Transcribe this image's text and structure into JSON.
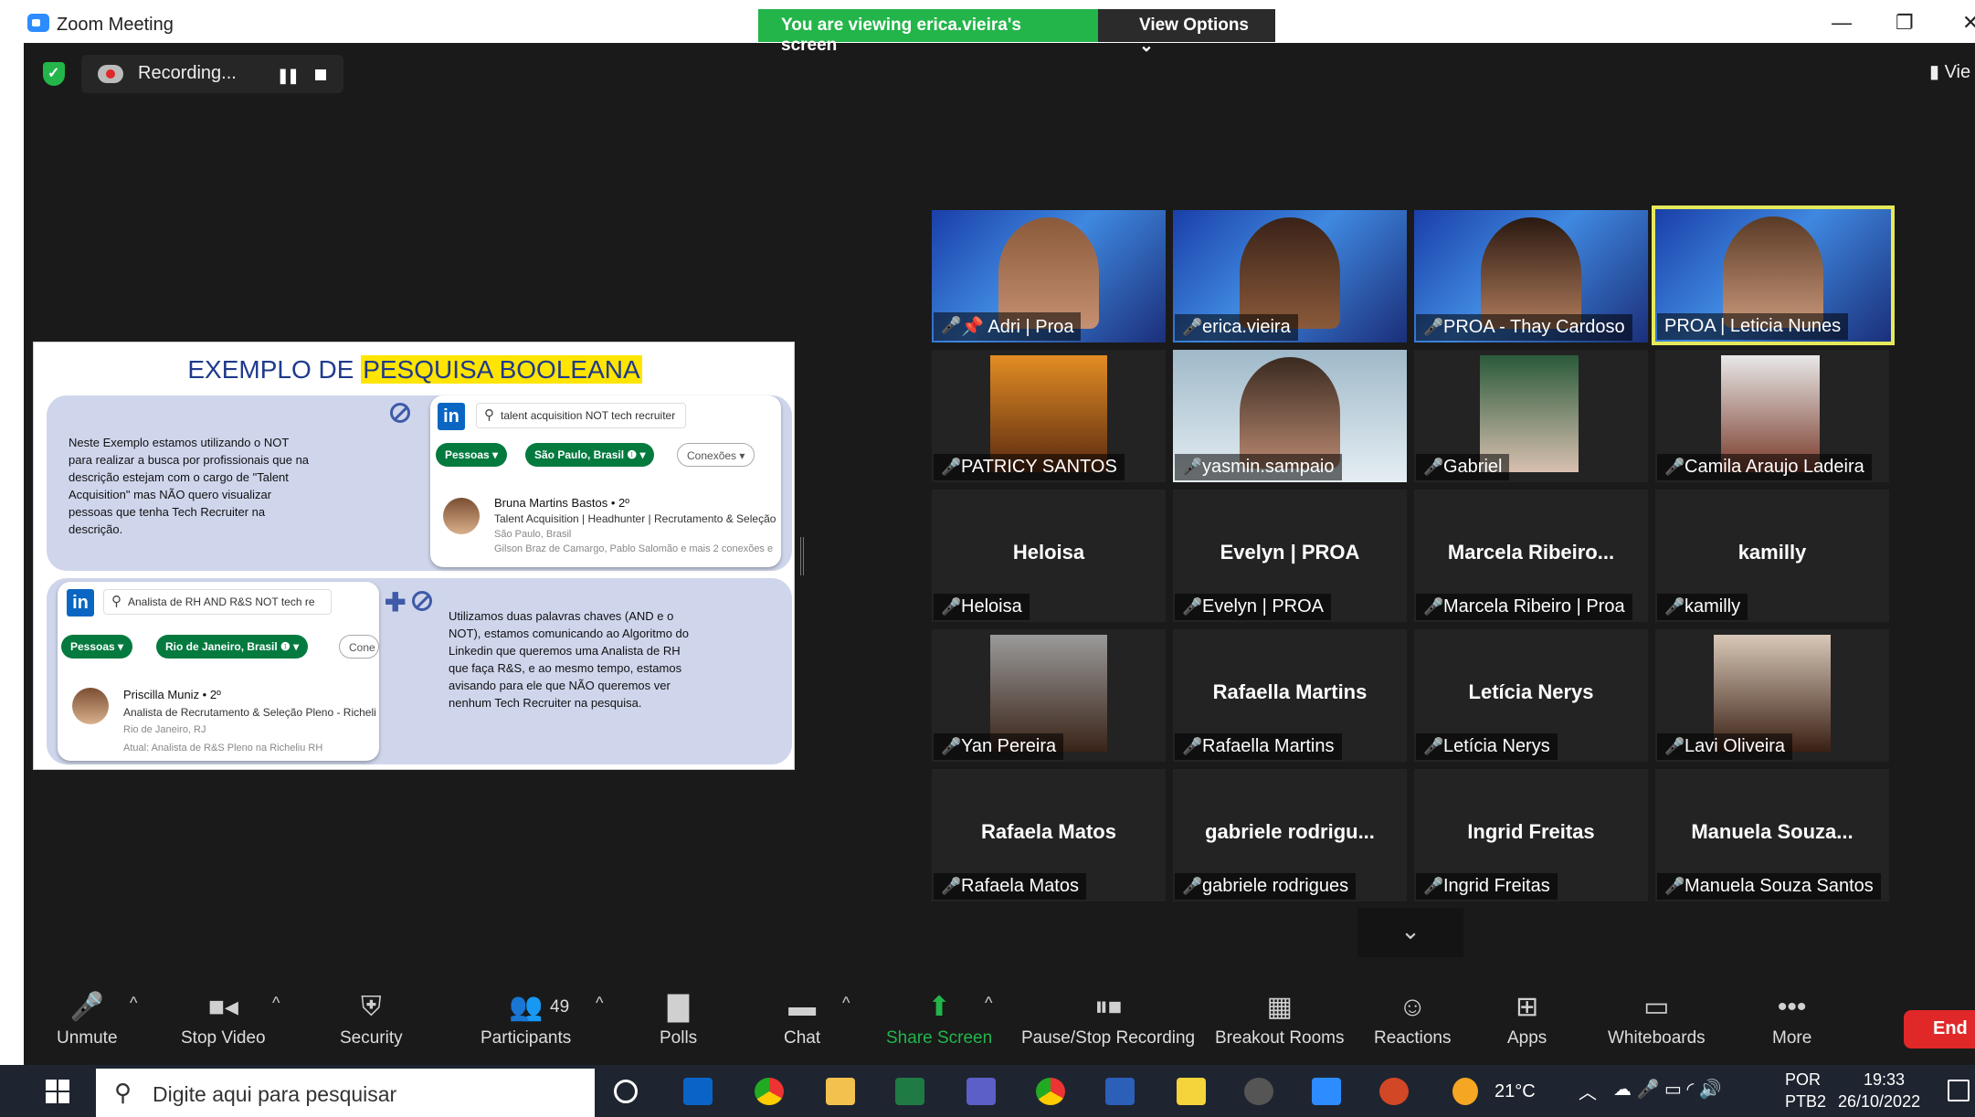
{
  "window": {
    "title": "Zoom Meeting",
    "minimize": "—",
    "restore": "❐",
    "close": "✕"
  },
  "banner": {
    "viewing": "You are viewing erica.vieira's screen",
    "view_options": "View Options ⌄"
  },
  "recording": {
    "label": "Recording...",
    "pause": "❚❚"
  },
  "view_button": "Vie",
  "slide": {
    "title_prefix": "EXEMPLO DE ",
    "title_highlight": "PESQUISA BOOLEANA",
    "example1": {
      "text_lines": [
        "Neste Exemplo estamos utilizando o NOT",
        "para realizar a busca por profissionais que na",
        "descrição estejam com o cargo de \"Talent",
        "Acquisition\" mas NÃO quero visualizar",
        "pessoas  que tenha Tech Recruiter na",
        "descrição."
      ],
      "search": "talent acquisition NOT tech recruiter",
      "pills": [
        "Pessoas ▾",
        "São Paulo, Brasil ❶ ▾",
        "Conexões ▾"
      ],
      "person_name": "Bruna Martins Bastos • 2º",
      "person_title": "Talent Acquisition | Headhunter | Recrutamento & Seleção",
      "person_location": "São Paulo, Brasil",
      "person_connections": "Gilson Braz de Camargo, Pablo Salomão e mais 2 conexões e"
    },
    "example2": {
      "search": "Analista de RH AND R&S NOT tech re",
      "pills": [
        "Pessoas ▾",
        "Rio de Janeiro, Brasil ❶ ▾",
        "Cone"
      ],
      "person_name": "Priscilla Muniz • 2º",
      "person_title": "Analista de Recrutamento & Seleção Pleno - Richeli",
      "person_location": "Rio de Janeiro, RJ",
      "person_current": "Atual: Analista de R&S Pleno na Richeliu RH",
      "text_lines": [
        "Utilizamos duas palavras chaves (AND e o",
        "NOT), estamos comunicando ao Algoritmo do",
        "Linkedin que queremos uma Analista de RH",
        "que faça R&S, e ao mesmo tempo, estamos",
        "avisando para ele que NÃO queremos ver",
        "nenhum Tech Recruiter na pesquisa."
      ]
    },
    "li_label": "in",
    "plus": "✚"
  },
  "participants": [
    {
      "name": "Adri | Proa",
      "big": ""
    },
    {
      "name": "erica.vieira",
      "big": ""
    },
    {
      "name": "PROA - Thay Cardoso",
      "big": ""
    },
    {
      "name": "PROA | Leticia Nunes",
      "big": ""
    },
    {
      "name": "PATRICY SANTOS",
      "big": ""
    },
    {
      "name": "yasmin.sampaio",
      "big": ""
    },
    {
      "name": "Gabriel",
      "big": ""
    },
    {
      "name": "Camila Araujo Ladeira",
      "big": ""
    },
    {
      "name": "Heloisa",
      "big": "Heloisa"
    },
    {
      "name": "Evelyn | PROA",
      "big": "Evelyn | PROA"
    },
    {
      "name": "Marcela Ribeiro | Proa",
      "big": "Marcela  Ribeiro..."
    },
    {
      "name": "kamilly",
      "big": "kamilly"
    },
    {
      "name": "Yan Pereira",
      "big": ""
    },
    {
      "name": "Rafaella Martins",
      "big": "Rafaella Martins"
    },
    {
      "name": "Letícia Nerys",
      "big": "Letícia Nerys"
    },
    {
      "name": "Lavi Oliveira",
      "big": ""
    },
    {
      "name": "Rafaela Matos",
      "big": "Rafaela Matos"
    },
    {
      "name": "gabriele rodrigues",
      "big": "gabriele  rodrigu..."
    },
    {
      "name": "Ingrid Freitas",
      "big": "Ingrid Freitas"
    },
    {
      "name": "Manuela Souza Santos",
      "big": "Manuela  Souza..."
    }
  ],
  "gallery_down": "⌄",
  "toolbar": {
    "unmute": "Unmute",
    "stop_video": "Stop Video",
    "security": "Security",
    "participants": "Participants",
    "participants_count": "49",
    "polls": "Polls",
    "chat": "Chat",
    "share_screen": "Share Screen",
    "pause_recording": "Pause/Stop Recording",
    "breakout": "Breakout Rooms",
    "reactions": "Reactions",
    "apps": "Apps",
    "whiteboards": "Whiteboards",
    "more": "More",
    "end": "End",
    "caret": "^"
  },
  "taskbar": {
    "search_placeholder": "Digite aqui para pesquisar",
    "weather": "21°C",
    "lang1": "POR",
    "lang2": "PTB2",
    "time": "19:33",
    "date": "26/10/2022"
  },
  "colors": {
    "accent_green": "#23b54a",
    "end_red": "#e02828",
    "active_speaker": "#e6e95a",
    "linkedin": "#0a66c2"
  }
}
